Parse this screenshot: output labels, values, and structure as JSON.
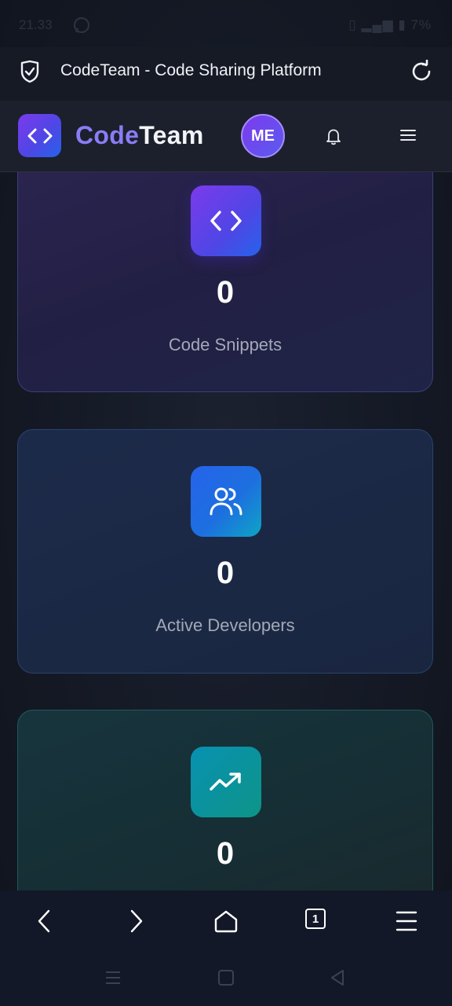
{
  "status_bar": {
    "time": "21.33",
    "battery": "7%"
  },
  "browser": {
    "page_title": "CodeTeam - Code Sharing Platform",
    "tab_count": "1"
  },
  "header": {
    "brand_code": "Code",
    "brand_team": "Team",
    "avatar_initials": "ME"
  },
  "stats": [
    {
      "value": "0",
      "label": "Code Snippets",
      "icon": "code-icon"
    },
    {
      "value": "0",
      "label": "Active Developers",
      "icon": "users-icon"
    },
    {
      "value": "0",
      "label": "",
      "icon": "trending-up-icon"
    }
  ],
  "colors": {
    "brand_purple": "#7c3aed",
    "brand_blue": "#2563eb",
    "brand_teal": "#0d9488",
    "background": "#141925"
  }
}
